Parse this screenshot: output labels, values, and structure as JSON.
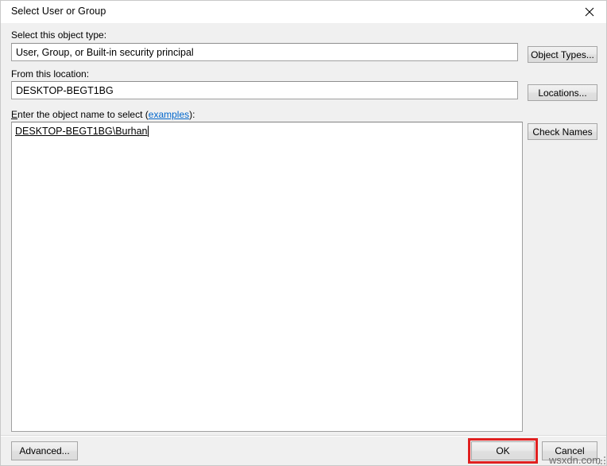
{
  "window": {
    "title": "Select User or Group",
    "close_icon": "close-icon"
  },
  "object_type": {
    "label": "Select this object type:",
    "value": "User, Group, or Built-in security principal",
    "button_label": "Object Types..."
  },
  "location": {
    "label": "From this location:",
    "value": "DESKTOP-BEGT1BG",
    "button_label": "Locations..."
  },
  "object_name": {
    "label_prefix": "Enter the object name to select (",
    "label_accesskey": "E",
    "label_rest": "nter the object name to select (",
    "link_label": "examples",
    "label_suffix": "):",
    "value": "DESKTOP-BEGT1BG\\Burhan",
    "button_label": "Check Names"
  },
  "footer": {
    "advanced_label": "Advanced...",
    "ok_label": "OK",
    "cancel_label": "Cancel"
  },
  "annotation": {
    "highlight_color": "#e02020",
    "target": "OK"
  },
  "watermark": {
    "text": "wsxdn.com"
  }
}
